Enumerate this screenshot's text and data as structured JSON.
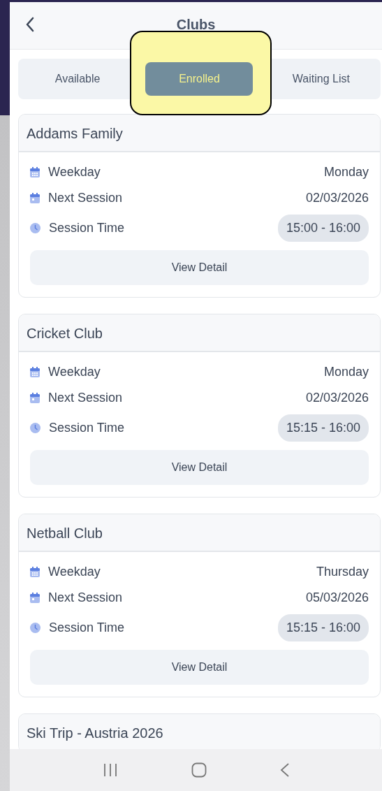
{
  "header": {
    "title": "Clubs"
  },
  "tabs": [
    {
      "label": "Available",
      "selected": false
    },
    {
      "label": "Enrolled",
      "selected": true,
      "highlighted": true
    },
    {
      "label": "Waiting List",
      "selected": false
    }
  ],
  "clubs": [
    {
      "name": "Addams Family",
      "rows": [
        {
          "kind": "weekday",
          "label": "Weekday",
          "value": "Monday"
        },
        {
          "kind": "date",
          "label": "Next Session",
          "value": "02/03/2026"
        },
        {
          "kind": "time",
          "label": "Session Time",
          "value": "15:00 - 16:00"
        }
      ],
      "button": "View Detail"
    },
    {
      "name": "Cricket Club",
      "rows": [
        {
          "kind": "weekday",
          "label": "Weekday",
          "value": "Monday"
        },
        {
          "kind": "date",
          "label": "Next Session",
          "value": "02/03/2026"
        },
        {
          "kind": "time",
          "label": "Session Time",
          "value": "15:15 - 16:00"
        }
      ],
      "button": "View Detail"
    },
    {
      "name": "Netball Club",
      "rows": [
        {
          "kind": "weekday",
          "label": "Weekday",
          "value": "Thursday"
        },
        {
          "kind": "date",
          "label": "Next Session",
          "value": "05/03/2026"
        },
        {
          "kind": "time",
          "label": "Session Time",
          "value": "15:15 - 16:00"
        }
      ],
      "button": "View Detail"
    },
    {
      "name": "Ski Trip - Austria 2026"
    }
  ]
}
